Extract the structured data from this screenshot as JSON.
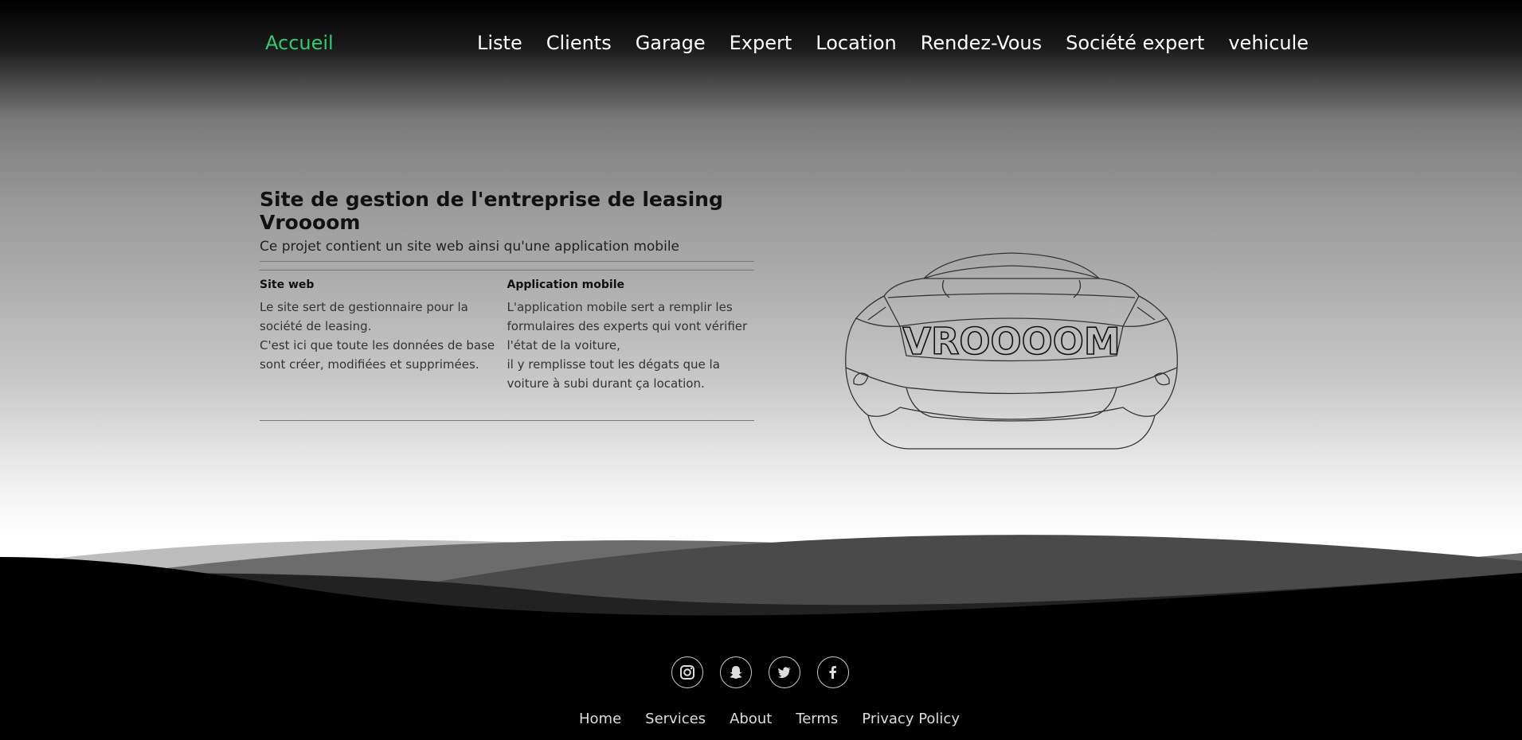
{
  "nav": {
    "brand": "Accueil",
    "items": [
      "Liste",
      "Clients",
      "Garage",
      "Expert",
      "Location",
      "Rendez-Vous",
      "Société expert",
      "vehicule"
    ],
    "brand_color": "#2ecc71"
  },
  "intro": {
    "title": "Site de gestion de l'entreprise de leasing Vroooom",
    "subtitle": "Ce projet contient un site web ainsi qu'une application mobile",
    "columns": [
      {
        "heading": "Site web",
        "lines": [
          "Le site sert de gestionnaire pour la société de leasing.",
          "C'est ici que toute les données de base sont créer, modifiées et supprimées."
        ]
      },
      {
        "heading": "Application mobile",
        "lines": [
          "L'application mobile sert a remplir les formulaires des experts qui vont vérifier l'état de la voiture,",
          "il y remplisse tout les dégats que la voiture à subi durant ça location."
        ]
      }
    ]
  },
  "car": {
    "logo_text": "VROOOOM",
    "icon": "car-front-outline-icon"
  },
  "footer": {
    "socials": [
      "instagram-icon",
      "snapchat-icon",
      "twitter-icon",
      "facebook-icon"
    ],
    "links": [
      "Home",
      "Services",
      "About",
      "Terms",
      "Privacy Policy"
    ]
  }
}
